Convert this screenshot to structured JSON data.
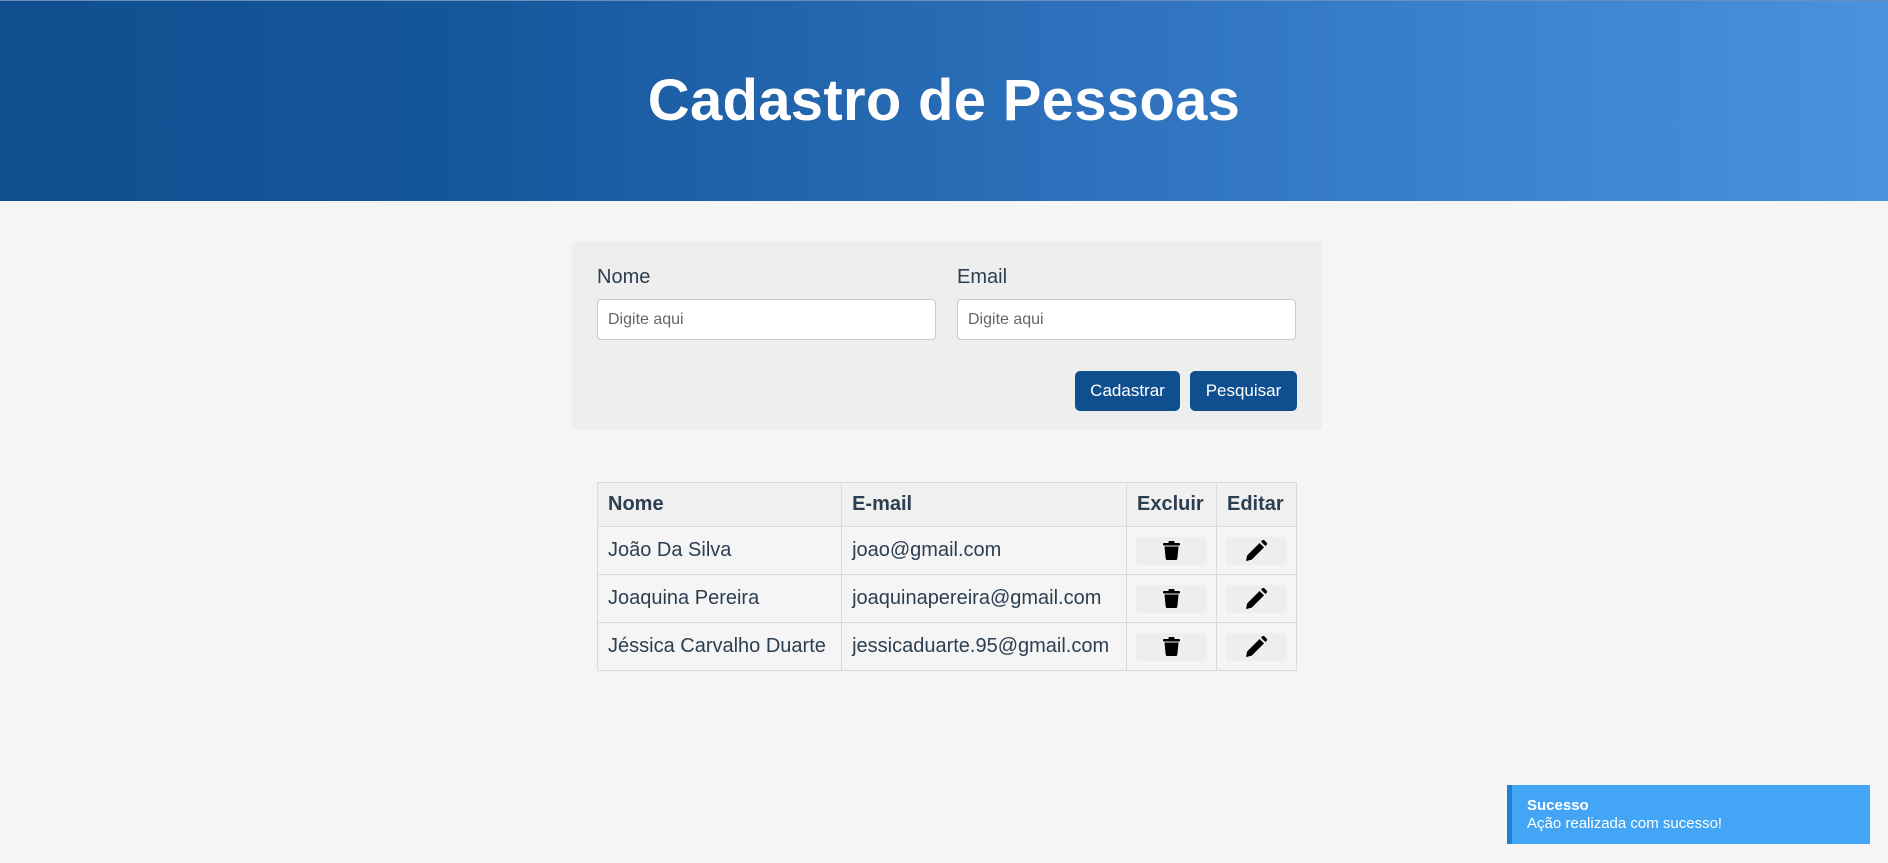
{
  "header": {
    "title": "Cadastro de Pessoas"
  },
  "form": {
    "name_label": "Nome",
    "name_placeholder": "Digite aqui",
    "email_label": "Email",
    "email_placeholder": "Digite aqui",
    "register_label": "Cadastrar",
    "search_label": "Pesquisar"
  },
  "table": {
    "headers": [
      "Nome",
      "E-mail",
      "Excluir",
      "Editar"
    ],
    "rows": [
      {
        "name": "João Da Silva",
        "email": "joao@gmail.com"
      },
      {
        "name": "Joaquina Pereira",
        "email": "joaquinapereira@gmail.com"
      },
      {
        "name": "Jéssica Carvalho Duarte",
        "email": "jessicaduarte.95@gmail.com"
      }
    ],
    "delete_icon": "trash-icon",
    "edit_icon": "pencil-icon"
  },
  "toast": {
    "title": "Sucesso",
    "detail": "Ação realizada com sucesso!"
  },
  "colors": {
    "primary": "#0f4f8f",
    "header_gradient_end": "#4a92dd",
    "toast_bg": "#42a5f5"
  }
}
